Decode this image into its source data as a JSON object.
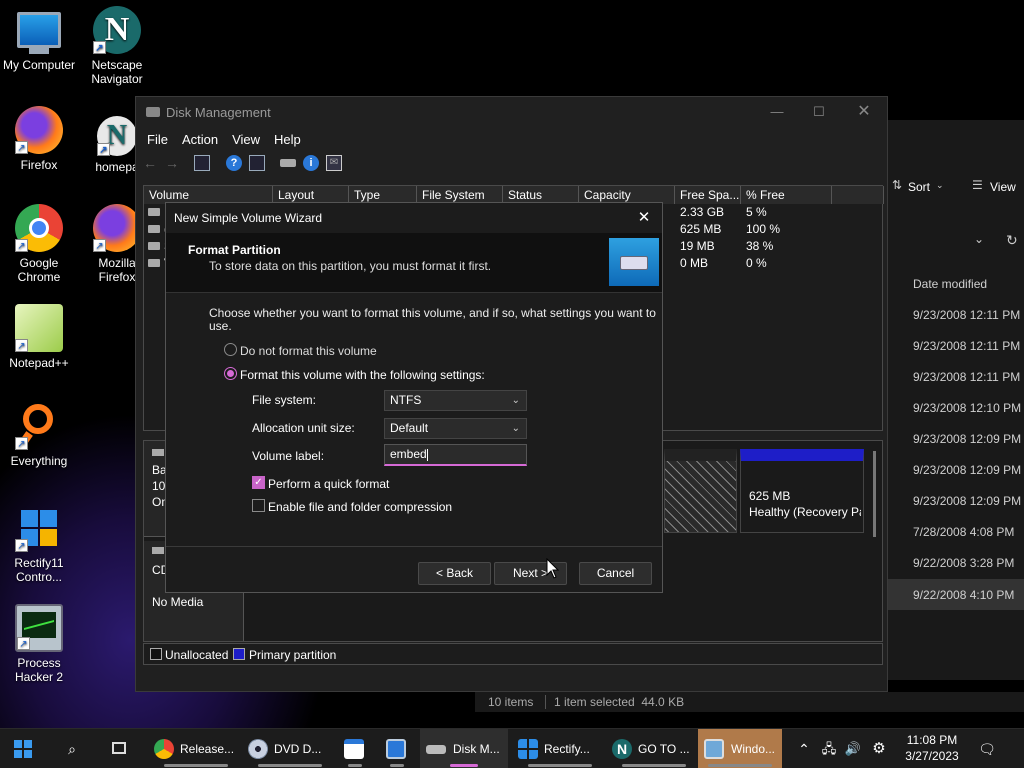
{
  "desktop": {
    "icons": [
      {
        "label1": "My Computer",
        "label2": ""
      },
      {
        "label1": "Netscape",
        "label2": "Navigator"
      },
      {
        "label1": "Firefox",
        "label2": ""
      },
      {
        "label1": "homepa",
        "label2": ""
      },
      {
        "label1": "Google",
        "label2": "Chrome"
      },
      {
        "label1": "Mozilla",
        "label2": "Firefox"
      },
      {
        "label1": "Notepad++",
        "label2": ""
      },
      {
        "label1": "Everything",
        "label2": ""
      },
      {
        "label1": "Rectify11",
        "label2": "Contro..."
      },
      {
        "label1": "Process",
        "label2": "Hacker 2"
      }
    ]
  },
  "explorer": {
    "sort_label": "Sort",
    "view_label": "View",
    "col_date_modified": "Date modified",
    "dates": [
      "9/23/2008 12:11 PM",
      "9/23/2008 12:11 PM",
      "9/23/2008 12:11 PM",
      "9/23/2008 12:10 PM",
      "9/23/2008 12:09 PM",
      "9/23/2008 12:09 PM",
      "9/23/2008 12:09 PM",
      "7/28/2008 4:08 PM",
      "9/22/2008 3:28 PM",
      "9/22/2008 4:10 PM"
    ],
    "status_items": "10 items",
    "status_selected": "1 item selected  44.0 KB"
  },
  "diskmgmt": {
    "title": "Disk Management",
    "menu": [
      "File",
      "Action",
      "View",
      "Help"
    ],
    "columns": [
      "Volume",
      "Layout",
      "Type",
      "File System",
      "Status",
      "Capacity",
      "Free Spa...",
      "% Free"
    ],
    "rows": [
      {
        "free": "2.33 GB",
        "pct": "5 %"
      },
      {
        "free": "625 MB",
        "pct": "100 %"
      },
      {
        "free": "19 MB",
        "pct": "38 %"
      },
      {
        "free": "0 MB",
        "pct": "0 %"
      }
    ],
    "vol_partial": [
      "",
      "(",
      "S",
      "V"
    ],
    "disk0_label_lines": [
      "Bas",
      "100",
      "On"
    ],
    "recovery_size": "625 MB",
    "recovery_status": "Healthy (Recovery Pa",
    "cdrom_label": "CD",
    "cdrom_media": "No Media",
    "legend_unallocated": "Unallocated",
    "legend_primary": "Primary partition",
    "colors": {
      "primary": "#1e1ec8",
      "unallocated": "#111111"
    }
  },
  "wizard": {
    "title": "New Simple Volume Wizard",
    "heading": "Format Partition",
    "subheading": "To store data on this partition, you must format it first.",
    "intro": "Choose whether you want to format this volume, and if so, what settings you want to",
    "intro2": "use.",
    "radio_no_format": "Do not format this volume",
    "radio_format": "Format this volume with the following settings:",
    "file_system_label": "File system:",
    "file_system_value": "NTFS",
    "alloc_label": "Allocation unit size:",
    "alloc_value": "Default",
    "volume_label_label": "Volume label:",
    "volume_label_value": "embed",
    "quick_format_label": "Perform a quick format",
    "quick_format_checked": true,
    "compression_label": "Enable file and folder compression",
    "compression_checked": false,
    "back_label": "< Back",
    "next_label": "Next >",
    "cancel_label": "Cancel"
  },
  "taskbar": {
    "items": [
      "Release...",
      "DVD D...",
      "",
      "",
      "Disk M...",
      "Rectify...",
      "GO TO ...",
      "Windo..."
    ],
    "time": "11:08 PM",
    "date": "3/27/2023"
  }
}
